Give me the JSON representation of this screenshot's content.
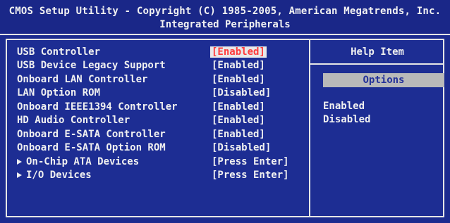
{
  "header": {
    "line1": "CMOS Setup Utility - Copyright (C) 1985-2005, American Megatrends, Inc.",
    "line2": "Integrated Peripherals"
  },
  "settings": [
    {
      "label": "USB Controller",
      "value": "[Enabled]",
      "selected": true,
      "submenu": false
    },
    {
      "label": "USB Device Legacy Support",
      "value": "[Enabled]",
      "selected": false,
      "submenu": false
    },
    {
      "label": "Onboard LAN Controller",
      "value": "[Enabled]",
      "selected": false,
      "submenu": false
    },
    {
      "label": "LAN Option ROM",
      "value": "[Disabled]",
      "selected": false,
      "submenu": false
    },
    {
      "label": "Onboard IEEE1394 Controller",
      "value": "[Enabled]",
      "selected": false,
      "submenu": false
    },
    {
      "label": "HD Audio Controller",
      "value": "[Enabled]",
      "selected": false,
      "submenu": false
    },
    {
      "label": "Onboard E-SATA Controller",
      "value": "[Enabled]",
      "selected": false,
      "submenu": false
    },
    {
      "label": "Onboard E-SATA Option ROM",
      "value": "[Disabled]",
      "selected": false,
      "submenu": false
    },
    {
      "label": "On-Chip ATA Devices",
      "value": "[Press Enter]",
      "selected": false,
      "submenu": true
    },
    {
      "label": "I/O Devices",
      "value": "[Press Enter]",
      "selected": false,
      "submenu": true
    }
  ],
  "help": {
    "title": "Help Item",
    "options_label": "Options",
    "options": [
      "Enabled",
      "Disabled"
    ]
  },
  "colors": {
    "background": "#1c2b8f",
    "text": "#f0f0f0",
    "selected_value": "#ff3b3b",
    "highlight_bar": "#b9b9b9"
  }
}
